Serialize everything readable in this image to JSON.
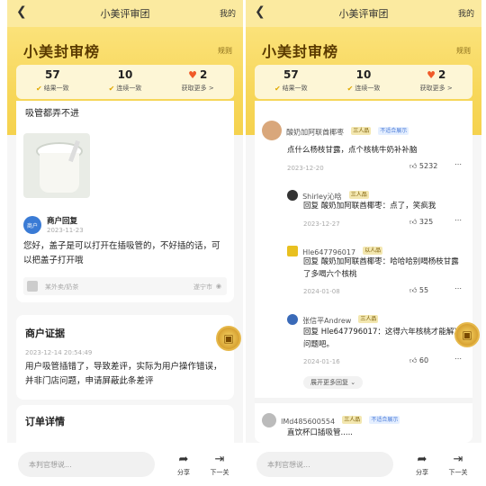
{
  "left": {
    "header": {
      "title": "小美评审团",
      "mine": "我的"
    },
    "brand": "小美封审榜",
    "rules": "规则",
    "stats": [
      {
        "value": "57",
        "label": "结果一致"
      },
      {
        "value": "10",
        "label": "连续一致"
      },
      {
        "value": "2",
        "label": "获取更多 >"
      }
    ],
    "review": {
      "text": "吸管都弄不进"
    },
    "merchant_reply": {
      "avatar_text": "商户",
      "title": "商户回复",
      "date": "2023-11-23",
      "text": "您好，盖子是可以打开在插吸管的，不好插的话，可以把盖子打开哦",
      "shop_type": "某外卖/奶茶",
      "location": "遂宁市"
    },
    "evidence": {
      "title": "商户证据",
      "datetime": "2023-12-14 20:54:49",
      "text": "用户吸管插错了，导致差评，实际为用户操作错误，并非门店问题，申请屏蔽此条差评"
    },
    "order": {
      "title": "订单详情"
    },
    "bottom": {
      "placeholder": "本判官想说...",
      "share": "分享",
      "next": "下一关"
    }
  },
  "right": {
    "header": {
      "title": "小美评审团",
      "mine": "我的"
    },
    "brand": "小美封审榜",
    "rules": "规则",
    "stats": [
      {
        "value": "57",
        "label": "结果一致"
      },
      {
        "value": "10",
        "label": "连续一致"
      },
      {
        "value": "2",
        "label": "获取更多 >"
      }
    ],
    "comments": [
      {
        "name": "酸奶加阿联酋椰枣",
        "badge1": "三人品",
        "badge2": "不适合展示",
        "text": "点什么杨枝甘露，点个核桃牛奶补补脑",
        "date": "2023-12-20",
        "likes": "5232"
      },
      {
        "name": "Shirley沁晗",
        "badge1": "三人品",
        "text": "回复  酸奶加阿联酋椰枣：点了，笑疯我",
        "date": "2023-12-27",
        "likes": "325"
      },
      {
        "name": "Hle647796017",
        "badge1": "以人品",
        "text": "回复  酸奶加阿联酋椰枣：哈哈哈别喝杨枝甘露了多喝六个核桃",
        "date": "2024-01-08",
        "likes": "55"
      },
      {
        "name": "张信平Andrew",
        "badge1": "三人品",
        "text": "回复  Hle647796017：这得六年核桃才能解决问题吧。",
        "date": "2024-01-16",
        "likes": "60"
      }
    ],
    "expand": "展开更多回复",
    "last_comment": {
      "name": "lMd485600554",
      "badge1": "三人品",
      "badge2": "不适合展示",
      "text": "直饮杯口插吸管....."
    },
    "bottom": {
      "placeholder": "本判官想说...",
      "share": "分享",
      "next": "下一关"
    }
  }
}
